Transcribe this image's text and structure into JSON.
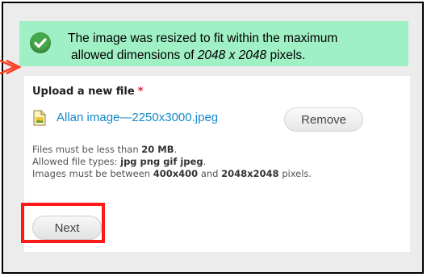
{
  "status": {
    "line1": "The image was resized to fit within the maximum",
    "line2_prefix": "allowed dimensions of ",
    "line2_dims": "2048 x 2048",
    "line2_suffix": " pixels.",
    "icon": "check-circle-icon",
    "color": "#9ff0c4"
  },
  "upload": {
    "label": "Upload a new file",
    "required_marker": "*",
    "file_name": "Allan image—2250x3000.jpeg",
    "file_icon": "image-file-icon",
    "remove_label": "Remove",
    "help": {
      "size_prefix": "Files must be less than ",
      "size_value": "20 MB",
      "size_suffix": ".",
      "types_prefix": "Allowed file types: ",
      "types_value": "jpg png gif jpeg",
      "types_suffix": ".",
      "dims_prefix": "Images must be between ",
      "dims_min": "400x400",
      "dims_mid": " and ",
      "dims_max": "2048x2048",
      "dims_suffix": " pixels."
    }
  },
  "actions": {
    "next_label": "Next"
  },
  "annotations": {
    "arrow_color": "#ff3b1f",
    "highlight_color": "#ff1a1a"
  }
}
